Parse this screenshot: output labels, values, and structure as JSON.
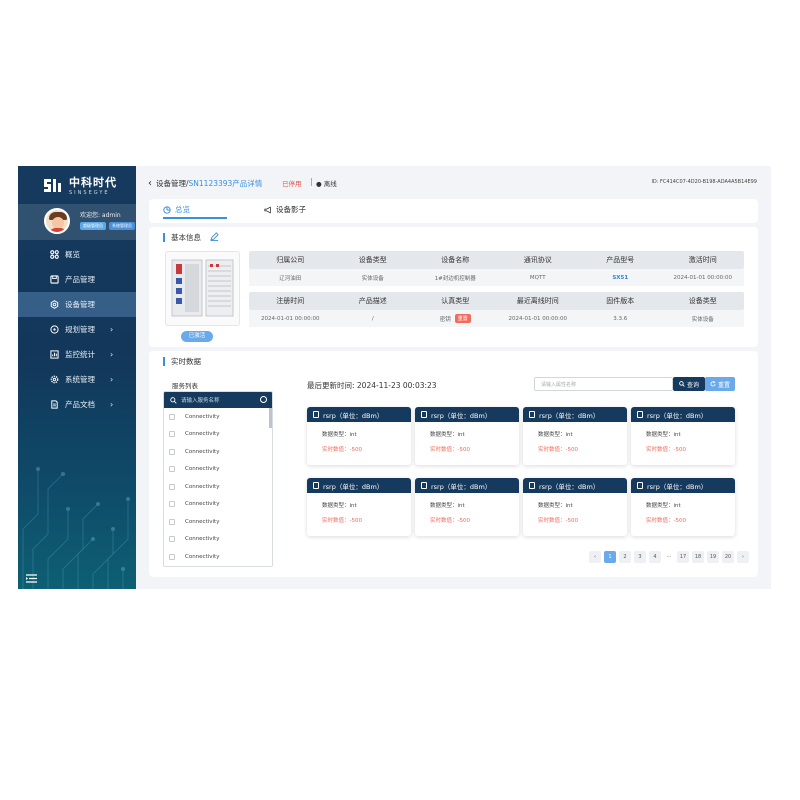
{
  "brand": {
    "name_cn": "中科时代",
    "name_en": "SINSEGYE"
  },
  "user": {
    "greeting": "欢迎您: admin",
    "tag1": "超级管理员",
    "tag2": "系统管理员"
  },
  "nav": [
    {
      "label": "概览",
      "icon": "grid-icon",
      "arrow": ""
    },
    {
      "label": "产品管理",
      "icon": "box-icon",
      "arrow": ""
    },
    {
      "label": "设备管理",
      "icon": "settings-icon",
      "arrow": "",
      "active": true
    },
    {
      "label": "规划管理",
      "icon": "cluster-icon",
      "arrow": "›"
    },
    {
      "label": "监控统计",
      "icon": "chart-icon",
      "arrow": "›"
    },
    {
      "label": "系统管理",
      "icon": "gear-icon",
      "arrow": "›"
    },
    {
      "label": "产品文档",
      "icon": "document-icon",
      "arrow": "›"
    }
  ],
  "header": {
    "crumb_root": "设备管理",
    "crumb_sep": "/",
    "crumb_current": "SN1123393产品详情",
    "status_off": "已停用",
    "status_online": "● 离线",
    "device_id": "ID: FC414C07-4D20-B198-ADA4A5B14E99"
  },
  "tabs": {
    "overview": "总览",
    "shadow": "设备影子"
  },
  "basic": {
    "title": "基本信息",
    "activated": "已激活",
    "row1_heads": [
      "归属公司",
      "设备类型",
      "设备名称",
      "通讯协议",
      "产品型号",
      "激活时间"
    ],
    "row1_vals": [
      "辽河油田",
      "实体设备",
      "1#封边机控制器",
      "MQTT",
      "SX51",
      "2024-01-01 00:00:00"
    ],
    "row2_heads": [
      "注册时间",
      "产品描述",
      "认真类型",
      "最近离线时间",
      "固件版本",
      "设备类型"
    ],
    "row2_vals": [
      "2024-01-01 00:00:00",
      "/",
      "密钥",
      "2024-01-01 00:00:00",
      "3.3.6",
      "实体设备"
    ],
    "reset_tag": "重置"
  },
  "realtime": {
    "title": "实时数据",
    "service_label": "服务列表",
    "service_search_placeholder": "请输入服务名称",
    "services": [
      "Connectivity",
      "Connectivity",
      "Connectivity",
      "Connectivity",
      "Connectivity",
      "Connectivity",
      "Connectivity",
      "Connectivity",
      "Connectivity"
    ],
    "last_update": "最后更新时间: 2024-11-23 00:03:23",
    "attr_search_placeholder": "请输入属性名称",
    "query_label": "查询",
    "reset_label": "重置",
    "cards": [
      {
        "title": "rsrp（单位：dBm）",
        "type": "数据类型：int",
        "value": "实时数值：-500"
      },
      {
        "title": "rsrp（单位：dBm）",
        "type": "数据类型：int",
        "value": "实时数值：-500"
      },
      {
        "title": "rsrp（单位：dBm）",
        "type": "数据类型：int",
        "value": "实时数值：-500"
      },
      {
        "title": "rsrp（单位：dBm）",
        "type": "数据类型：int",
        "value": "实时数值：-500"
      },
      {
        "title": "rsrp（单位：dBm）",
        "type": "数据类型：int",
        "value": "实时数值：-500"
      },
      {
        "title": "rsrp（单位：dBm）",
        "type": "数据类型：int",
        "value": "实时数值：-500"
      },
      {
        "title": "rsrp（单位：dBm）",
        "type": "数据类型：int",
        "value": "实时数值：-500"
      },
      {
        "title": "rsrp（单位：dBm）",
        "type": "数据类型：int",
        "value": "实时数值：-500"
      }
    ],
    "pager": [
      "‹",
      "1",
      "2",
      "3",
      "4",
      "···",
      "17",
      "18",
      "19",
      "20",
      "›"
    ],
    "pager_active": "1"
  },
  "colors": {
    "primary": "#163a5e",
    "accent": "#3a8fdf",
    "danger": "#f26b5b",
    "light_blue": "#6aa9ea"
  }
}
